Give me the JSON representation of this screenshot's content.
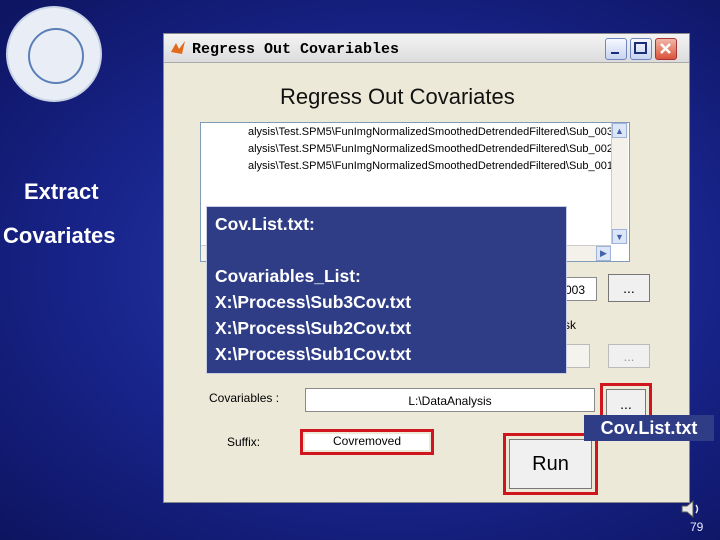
{
  "slide": {
    "labels": [
      "Extract",
      "Covariates"
    ],
    "page_number": "79",
    "accent_color": "#d0161c",
    "overlay_color": "#2f3d86"
  },
  "window": {
    "title": "Regress Out Covariables",
    "heading": "Regress Out Covariates",
    "list_items": [
      "alysis\\Test.SPM5\\FunImgNormalizedSmoothedDetrendedFiltered\\Sub_003",
      "alysis\\Test.SPM5\\FunImgNormalizedSmoothedDetrendedFiltered\\Sub_002",
      "alysis\\Test.SPM5\\FunImgNormalizedSmoothedDetrendedFiltered\\Sub_001"
    ],
    "partial_field_value": "003",
    "partial_label": "sk",
    "browse_label": "...",
    "covariables_label": "Covariables :",
    "covariables_value": "L:\\DataAnalysis",
    "suffix_label": "Suffix:",
    "suffix_value": "Covremoved",
    "run_label": "Run"
  },
  "overlay": {
    "heading": "Cov.List.txt:",
    "lines": [
      "Covariables_List:",
      "X:\\Process\\Sub3Cov.txt",
      "X:\\Process\\Sub2Cov.txt",
      "X:\\Process\\Sub1Cov.txt"
    ]
  },
  "callout": {
    "label": "Cov.List.txt"
  }
}
